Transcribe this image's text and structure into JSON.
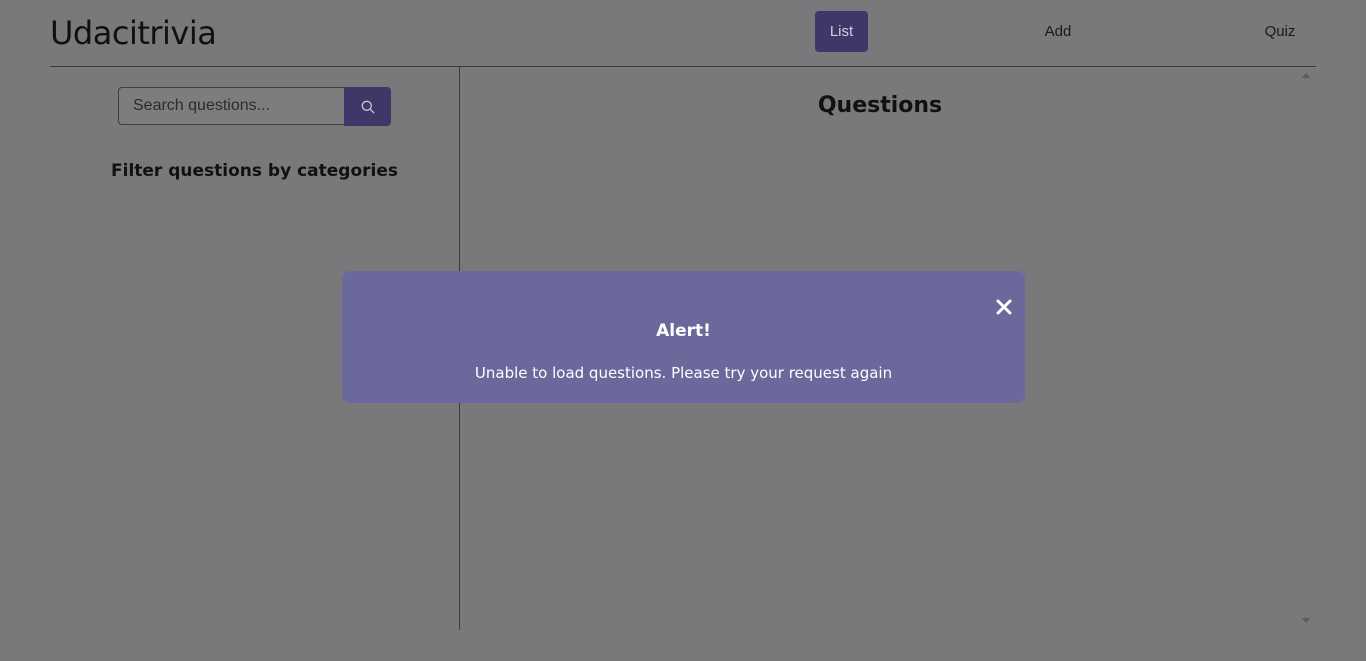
{
  "header": {
    "brand": "Udacitrivia",
    "nav": [
      {
        "label": "List",
        "active": true
      },
      {
        "label": "Add",
        "active": false
      },
      {
        "label": "Quiz",
        "active": false
      }
    ]
  },
  "sidebar": {
    "search": {
      "placeholder": "Search questions...",
      "value": "",
      "button_icon": "search-icon"
    },
    "filter_title": "Filter questions by categories",
    "categories": []
  },
  "main": {
    "title": "Questions",
    "questions": []
  },
  "alert": {
    "title": "Alert!",
    "message": "Unable to load questions. Please try your request again",
    "close_icon": "close-icon"
  },
  "colors": {
    "accent": "#3d3868",
    "alert_background": "#6b689c",
    "overlay_background": "#7a787a"
  }
}
